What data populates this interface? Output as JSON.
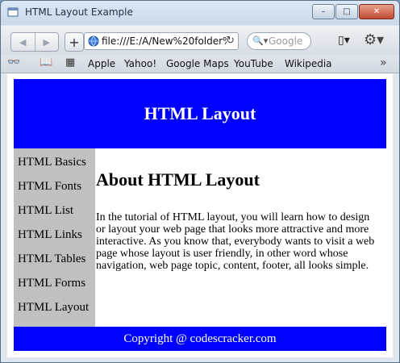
{
  "window": {
    "title": "HTML Layout Example",
    "buttons": {
      "minimize": "–",
      "maximize": "□",
      "close": "✕"
    }
  },
  "toolbar": {
    "back_icon": "◀",
    "forward_icon": "▶",
    "new_tab_icon": "+",
    "url": "file:///E:/A/New%20folder%",
    "reload_icon": "↻",
    "search_icon": "🔍▾",
    "search_placeholder": "Google",
    "page_menu_icon": "▯▾",
    "settings_icon": "⚙▾"
  },
  "bookmarks": {
    "reader_icon": "👓",
    "book_icon": "📖",
    "grid_icon": "▦",
    "items": [
      "Apple",
      "Yahoo!",
      "Google Maps",
      "YouTube",
      "Wikipedia"
    ],
    "more_icon": "»"
  },
  "page": {
    "header": "HTML Layout",
    "nav": [
      "HTML Basics",
      "HTML Fonts",
      "HTML List",
      "HTML Links",
      "HTML Tables",
      "HTML Forms",
      "HTML Layout"
    ],
    "heading": "About HTML Layout",
    "paragraph": "In the tutorial of HTML layout, you will learn how to design or layout your web page that looks more attractive and more interactive. As you know that, everybody wants to visit a web page whose layout is user friendly, in other word whose navigation, web page topic, content, footer, all looks simple.",
    "footer": "Copyright @ codescracker.com"
  },
  "colors": {
    "header_bg": "#0000ff",
    "nav_bg": "#c0c0c0",
    "footer_bg": "#0000ff"
  }
}
